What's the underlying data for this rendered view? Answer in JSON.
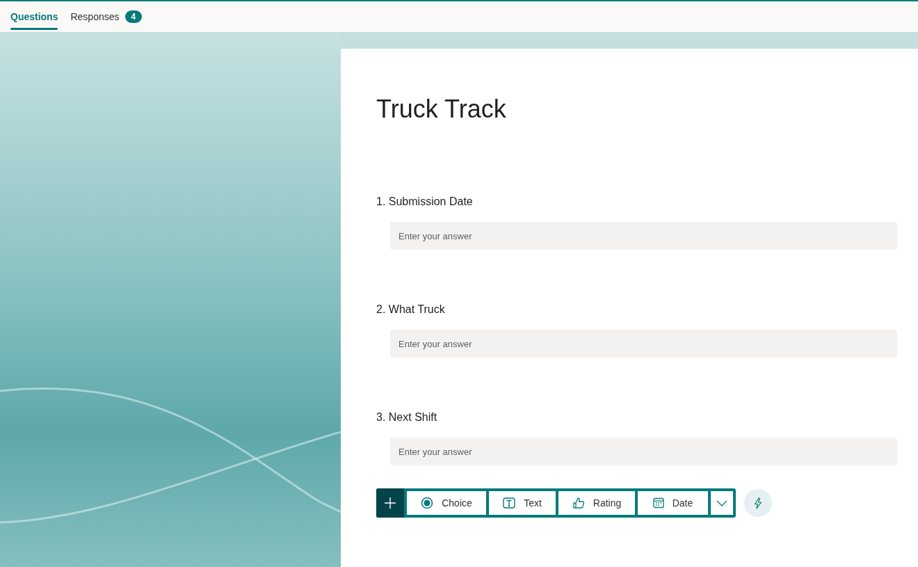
{
  "tabs": [
    {
      "label": "Questions",
      "selected": true
    },
    {
      "label": "Responses",
      "selected": false,
      "badge": "4"
    }
  ],
  "form": {
    "title": "Truck Track",
    "questions": [
      {
        "label": "1. Submission Date",
        "placeholder": "Enter your answer"
      },
      {
        "label": "2. What Truck",
        "placeholder": "Enter your answer"
      },
      {
        "label": "3. Next Shift",
        "placeholder": "Enter your answer"
      }
    ],
    "add_toolbar": {
      "types": [
        {
          "kind": "choice",
          "label": "Choice"
        },
        {
          "kind": "text",
          "label": "Text"
        },
        {
          "kind": "rating",
          "label": "Rating"
        },
        {
          "kind": "date",
          "label": "Date"
        }
      ]
    }
  }
}
